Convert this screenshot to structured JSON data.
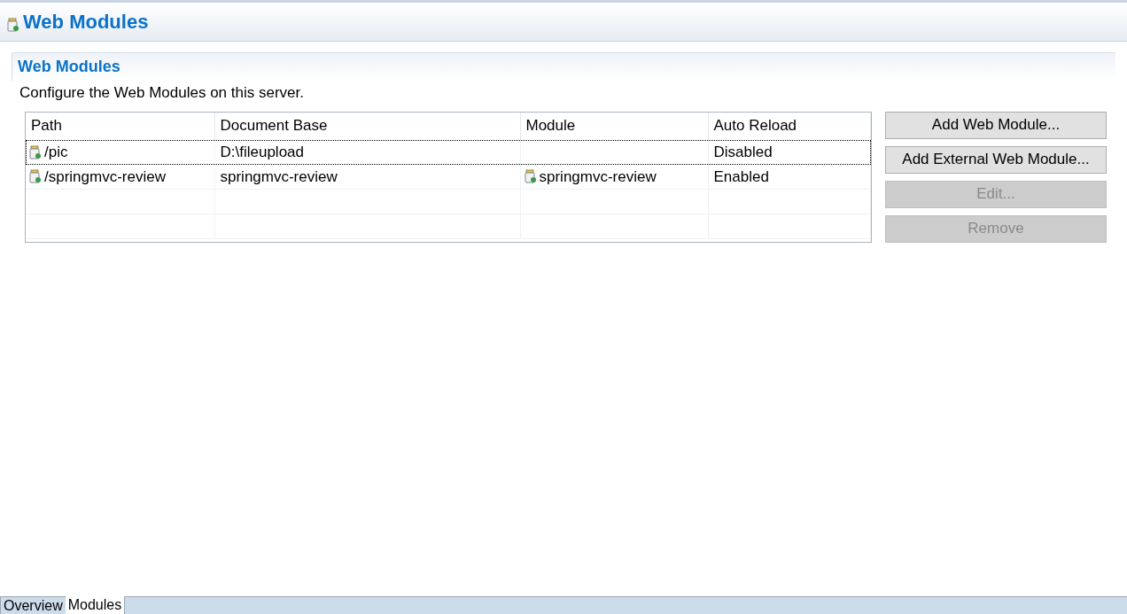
{
  "editor": {
    "title": "Web Modules"
  },
  "section": {
    "title": "Web Modules",
    "description": "Configure the Web Modules on this server."
  },
  "table": {
    "columns": [
      "Path",
      "Document Base",
      "Module",
      "Auto Reload"
    ],
    "rows": [
      {
        "path": "/pic",
        "document_base": "D:\\fileupload",
        "module": null,
        "auto_reload": "Disabled",
        "selected": true
      },
      {
        "path": "/springmvc-review",
        "document_base": "springmvc-review",
        "module": "springmvc-review",
        "auto_reload": "Enabled",
        "selected": false
      }
    ]
  },
  "buttons": [
    {
      "label": "Add Web Module...",
      "disabled": false
    },
    {
      "label": "Add External Web Module...",
      "disabled": false
    },
    {
      "label": "Edit...",
      "disabled": true
    },
    {
      "label": "Remove",
      "disabled": true
    }
  ],
  "tabs": [
    {
      "label": "Overview",
      "selected": false
    },
    {
      "label": "Modules",
      "selected": true
    }
  ]
}
